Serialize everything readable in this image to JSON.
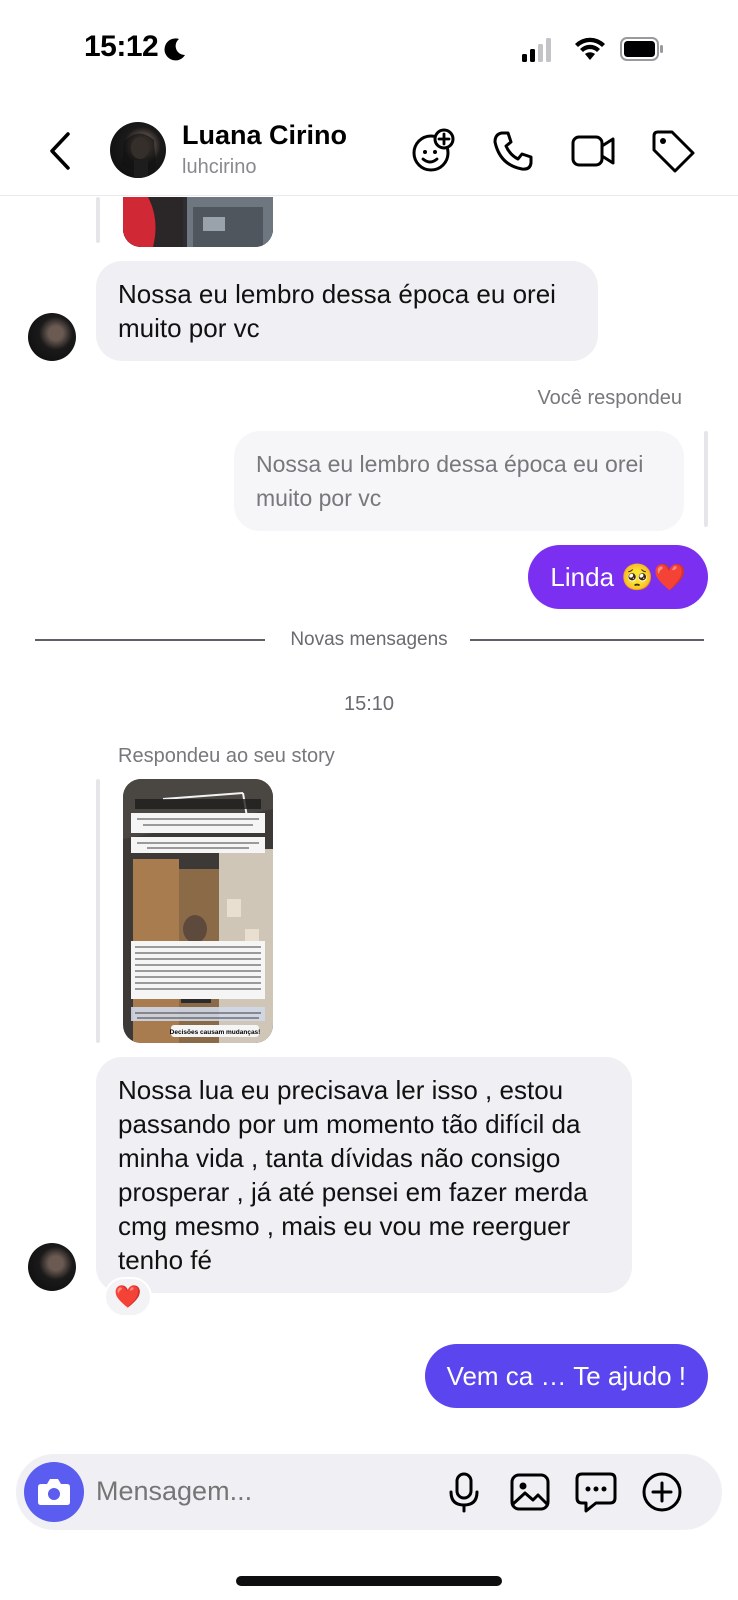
{
  "status_bar": {
    "time": "15:12"
  },
  "header": {
    "contact_name": "Luana Cirino",
    "contact_handle": "luhcirino",
    "icons": [
      "back-chevron-icon",
      "sticker-add-icon",
      "phone-icon",
      "video-icon",
      "tag-icon"
    ]
  },
  "messages": {
    "msg1": "Nossa eu lembro dessa época eu orei muito por vc",
    "you_replied": "Você respondeu",
    "quoted_reply": "Nossa eu lembro dessa época eu orei muito por vc",
    "reply_out": "Linda 🥺❤️",
    "new_messages": "Novas mensagens",
    "timestamp": "15:10",
    "story_reply_label": "Respondeu ao seu story",
    "msg2": "Nossa lua eu precisava ler isso , estou passando por um momento tão difícil da minha vida , tanta dívidas não consigo prosperar , já até pensei em fazer merda cmg mesmo , mais eu vou me reerguer tenho fé",
    "msg2_reaction": "❤️",
    "msg_out_last": "Vem ca … Te ajudo !"
  },
  "story_card": {
    "footer_text": "Decisões causam mudanças!"
  },
  "composer": {
    "placeholder": "Mensagem...",
    "icons": [
      "camera-icon",
      "microphone-icon",
      "gallery-icon",
      "sticker-chat-icon",
      "add-circle-icon"
    ]
  },
  "colors": {
    "outgoing_bubble": "#7b2ff0",
    "incoming_bubble": "#f0f0f4",
    "camera_button": "#5b5cf0"
  }
}
